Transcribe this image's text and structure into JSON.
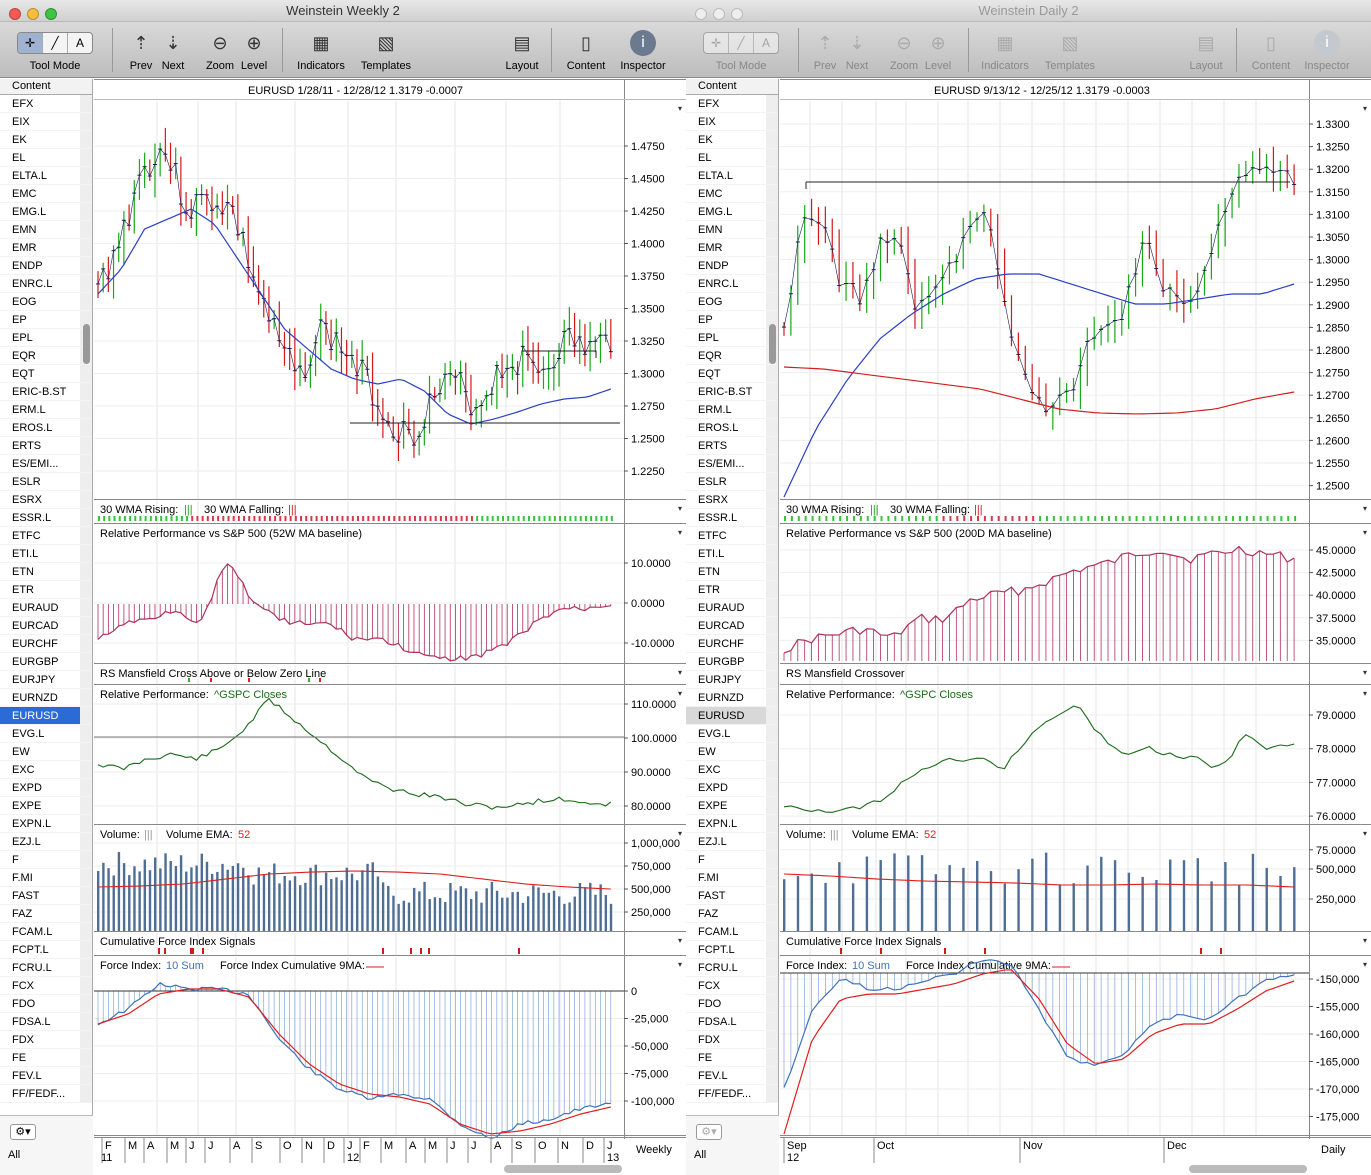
{
  "windows": [
    {
      "id": "L",
      "title": "Weinstein Weekly 2",
      "active": true,
      "toolbar": {
        "tool_mode": "Tool Mode",
        "prev": "Prev",
        "next": "Next",
        "zoom": "Zoom",
        "level": "Level",
        "indicators": "Indicators",
        "templates": "Templates",
        "layout": "Layout",
        "content": "Content",
        "inspector": "Inspector"
      },
      "header": "EURUSD   1/28/11 - 12/28/12      1.3179   -0.0007",
      "price_ticks": [
        "1.4750",
        "1.4500",
        "1.4250",
        "1.4000",
        "1.3750",
        "1.3500",
        "1.3250",
        "1.3000",
        "1.2750",
        "1.2500",
        "1.2250"
      ],
      "wma_label": "30 WMA Rising:",
      "wma_rising_icon": "|||",
      "wma_falling_label": "30 WMA Falling:",
      "wma_falling_icon": "|||",
      "rs_title": "Relative Performance vs S&P 500 (52W MA baseline)",
      "rs_ticks": [
        "10.0000",
        "0.0000",
        "-10.0000"
      ],
      "cross_title": "RS Mansfield Cross Above or Below Zero Line",
      "rp_title": "Relative Performance:",
      "rp_series": "^GSPC Closes",
      "rp_ticks": [
        "110.0000",
        "100.0000",
        "90.0000",
        "80.0000"
      ],
      "vol_title": "Volume:",
      "vol_icon": "|||",
      "vol_ema": "Volume EMA:",
      "vol_ema_val": "52",
      "vol_ticks": [
        "1,000,000",
        "750,000",
        "500,000",
        "250,000"
      ],
      "cfi_title": "Cumulative Force Index Signals",
      "fi_title": "Force Index:",
      "fi_sum": "10 Sum",
      "fi_cum": "Force Index Cumulative 9MA:",
      "fi_ticks": [
        "0",
        "-25,000",
        "-50,000",
        "-75,000",
        "-100,000"
      ],
      "months": [
        "F",
        "M",
        "A",
        "M",
        "J",
        "J",
        "A",
        "S",
        "O",
        "N",
        "D",
        "J",
        "F",
        "M",
        "A",
        "M",
        "J",
        "J",
        "A",
        "S",
        "O",
        "N",
        "D",
        "J"
      ],
      "years": [
        "11",
        "12",
        "13"
      ],
      "period": "Weekly"
    },
    {
      "id": "R",
      "title": "Weinstein Daily 2",
      "active": false,
      "toolbar": {
        "tool_mode": "Tool Mode",
        "prev": "Prev",
        "next": "Next",
        "zoom": "Zoom",
        "level": "Level",
        "indicators": "Indicators",
        "templates": "Templates",
        "layout": "Layout",
        "content": "Content",
        "inspector": "Inspector"
      },
      "header": "EURUSD   9/13/12 - 12/25/12      1.3179   -0.0003",
      "price_ticks": [
        "1.3300",
        "1.3250",
        "1.3200",
        "1.3150",
        "1.3100",
        "1.3050",
        "1.3000",
        "1.2950",
        "1.2900",
        "1.2850",
        "1.2800",
        "1.2750",
        "1.2700",
        "1.2650",
        "1.2600",
        "1.2550",
        "1.2500"
      ],
      "wma_label": "30 WMA Rising:",
      "wma_rising_icon": "|||",
      "wma_falling_label": "30 WMA Falling:",
      "wma_falling_icon": "|||",
      "rs_title": "Relative Performance vs S&P 500 (200D MA baseline)",
      "rs_ticks": [
        "45.0000",
        "42.5000",
        "40.0000",
        "37.5000",
        "35.0000"
      ],
      "cross_title": "RS Mansfield Crossover",
      "rp_title": "Relative Performance:",
      "rp_series": "^GSPC Closes",
      "rp_ticks": [
        "79.0000",
        "78.0000",
        "77.0000",
        "76.0000",
        "75.0000"
      ],
      "vol_title": "Volume:",
      "vol_icon": "|||",
      "vol_ema": "Volume EMA:",
      "vol_ema_val": "52",
      "vol_ticks": [
        "500,000",
        "250,000"
      ],
      "cfi_title": "Cumulative Force Index Signals",
      "fi_title": "Force Index:",
      "fi_sum": "10 Sum",
      "fi_cum": "Force Index Cumulative 9MA:",
      "fi_ticks": [
        "-150,000",
        "-155,000",
        "-160,000",
        "-165,000",
        "-170,000",
        "-175,000"
      ],
      "months": [
        "Sep",
        "Oct",
        "Nov",
        "Dec"
      ],
      "years": [
        "12"
      ],
      "period": "Daily"
    }
  ],
  "content_header": "Content",
  "symbols": [
    "EFX",
    "EIX",
    "EK",
    "EL",
    "ELTA.L",
    "EMC",
    "EMG.L",
    "EMN",
    "EMR",
    "ENDP",
    "ENRC.L",
    "EOG",
    "EP",
    "EPL",
    "EQR",
    "EQT",
    "ERIC-B.ST",
    "ERM.L",
    "EROS.L",
    "ERTS",
    "ES/EMI...",
    "ESLR",
    "ESRX",
    "ESSR.L",
    "ETFC",
    "ETI.L",
    "ETN",
    "ETR",
    "EURAUD",
    "EURCAD",
    "EURCHF",
    "EURGBP",
    "EURJPY",
    "EURNZD",
    "EURUSD",
    "EVG.L",
    "EW",
    "EXC",
    "EXPD",
    "EXPE",
    "EXPN.L",
    "EZJ.L",
    "F",
    "F.MI",
    "FAST",
    "FAZ",
    "FCAM.L",
    "FCPT.L",
    "FCRU.L",
    "FCX",
    "FDO",
    "FDSA.L",
    "FDX",
    "FE",
    "FEV.L",
    "FF/FEDF..."
  ],
  "selected_symbol": "EURUSD",
  "all_label": "All",
  "colors": {
    "up": "#18a818",
    "down": "#d41818",
    "bar": "#1a1a5a",
    "wma": "#2a3fc8",
    "ma200": "#d22020",
    "rs": "#b0305a",
    "rp": "#1a6a1a",
    "volbar": "#4f6e93",
    "fi": "#3e72b8",
    "fi9": "#e01e1e"
  }
}
